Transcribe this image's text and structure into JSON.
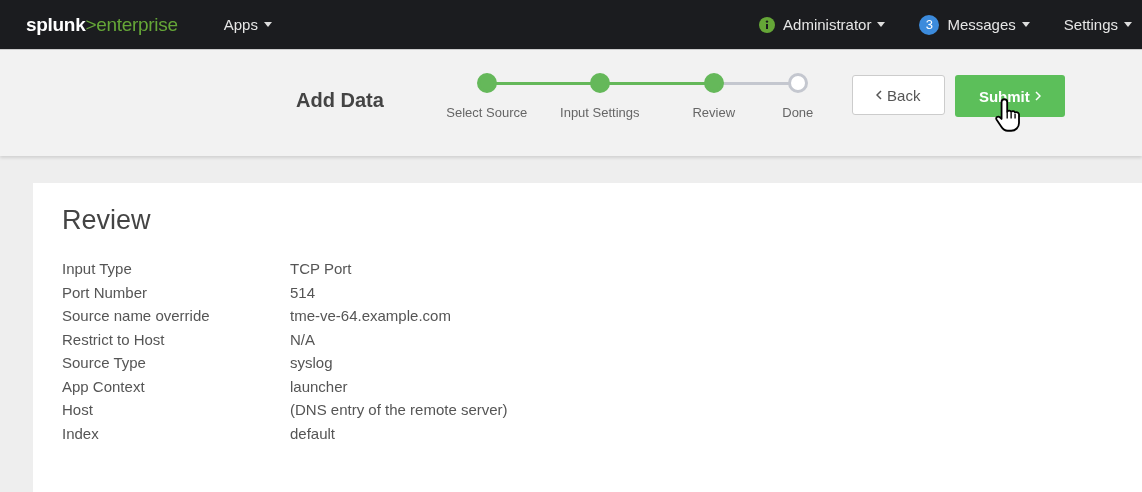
{
  "top_bar": {
    "brand": "splunk",
    "product": ">enterprise",
    "menus": [
      {
        "label": "Apps",
        "kind": "plain"
      },
      {
        "label": "Administrator",
        "kind": "info"
      },
      {
        "label": "Messages",
        "kind": "count",
        "badge": "3"
      },
      {
        "label": "Settings",
        "kind": "plain"
      }
    ]
  },
  "wizard": {
    "title": "Add Data",
    "steps": [
      {
        "label": "Select Source",
        "completed": true
      },
      {
        "label": "Input Settings",
        "completed": true
      },
      {
        "label": "Review",
        "completed": true
      },
      {
        "label": "Done",
        "completed": false
      }
    ],
    "back_button": "Back",
    "submit_button": "Submit"
  },
  "review": {
    "title": "Review",
    "rows": [
      {
        "label": "Input Type",
        "value": "TCP Port"
      },
      {
        "label": "Port Number",
        "value": "514"
      },
      {
        "label": "Source name override",
        "value": "tme-ve-64.example.com"
      },
      {
        "label": "Restrict to Host",
        "value": "N/A"
      },
      {
        "label": "Source Type",
        "value": "syslog"
      },
      {
        "label": "App Context",
        "value": "launcher"
      },
      {
        "label": "Host",
        "value": "(DNS entry of the remote server)"
      },
      {
        "label": "Index",
        "value": "default"
      }
    ]
  }
}
